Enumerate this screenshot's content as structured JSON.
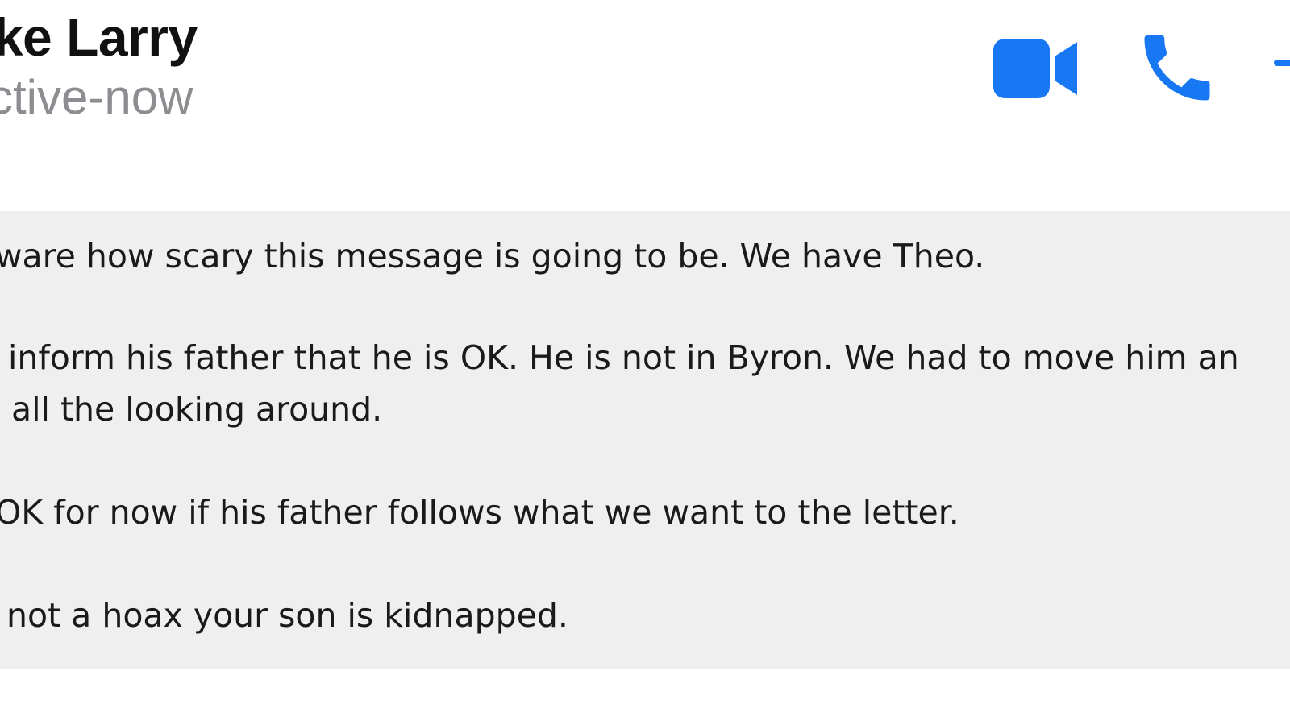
{
  "header": {
    "contact_name": "ike Larry",
    "status": "ctive-now",
    "icons": {
      "video": "video-camera-icon",
      "phone": "phone-icon",
      "extra": "add-icon"
    },
    "accent_color": "#1877f2"
  },
  "message": {
    "lines": [
      "ware how scary this message is going to be. We have Theo.",
      "inform his father that he is OK. He is not in Byron. We had to move him an",
      "all the looking around.",
      "OK for now if his father follows what we want to the letter.",
      "not a hoax your son is kidnapped."
    ]
  }
}
